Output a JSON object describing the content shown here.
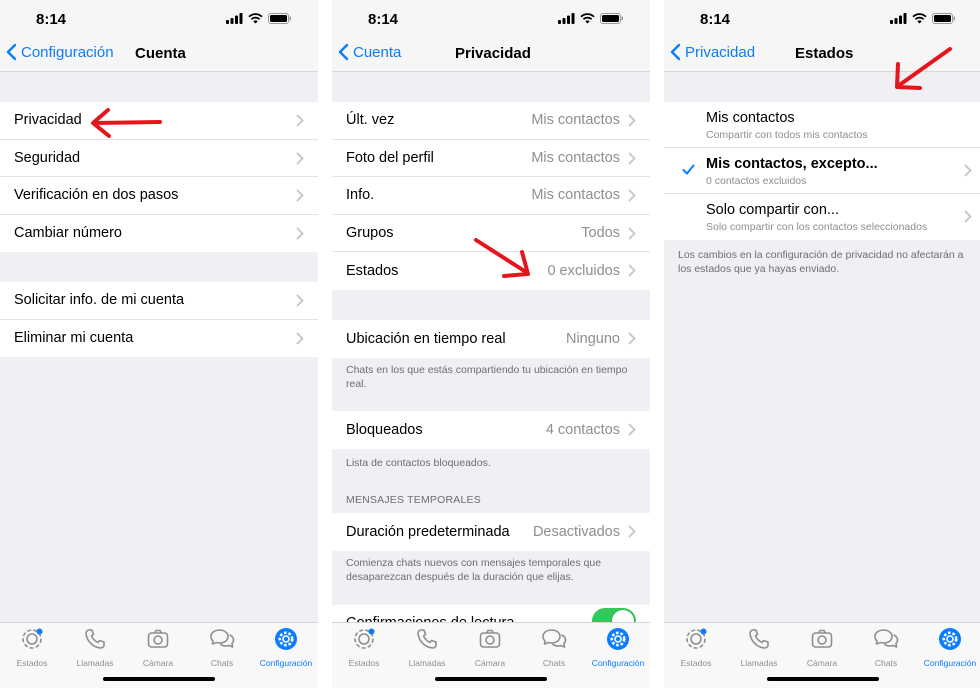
{
  "accent_color": "#0a7cff",
  "annotation_color": "#e8141b",
  "status": {
    "time": "8:14"
  },
  "tabs": [
    {
      "label": "Estados",
      "icon": "status-icon"
    },
    {
      "label": "Llamadas",
      "icon": "phone-icon"
    },
    {
      "label": "Cámara",
      "icon": "camera-icon"
    },
    {
      "label": "Chats",
      "icon": "chats-icon"
    },
    {
      "label": "Configuración",
      "icon": "gear-icon",
      "active": true
    }
  ],
  "screen1": {
    "back_label": "Configuración",
    "title": "Cuenta",
    "group1": [
      "Privacidad",
      "Seguridad",
      "Verificación en dos pasos",
      "Cambiar número"
    ],
    "group2": [
      "Solicitar info. de mi cuenta",
      "Eliminar mi cuenta"
    ]
  },
  "screen2": {
    "back_label": "Cuenta",
    "title": "Privacidad",
    "rows": [
      {
        "label": "Últ. vez",
        "value": "Mis contactos"
      },
      {
        "label": "Foto del perfil",
        "value": "Mis contactos"
      },
      {
        "label": "Info.",
        "value": "Mis contactos"
      },
      {
        "label": "Grupos",
        "value": "Todos"
      },
      {
        "label": "Estados",
        "value": "0 excluidos"
      }
    ],
    "location": {
      "label": "Ubicación en tiempo real",
      "value": "Ninguno"
    },
    "location_note": "Chats en los que estás compartiendo tu ubicación en tiempo real.",
    "blocked": {
      "label": "Bloqueados",
      "value": "4 contactos"
    },
    "blocked_note": "Lista de contactos bloqueados.",
    "temp_header": "MENSAJES TEMPORALES",
    "duration": {
      "label": "Duración predeterminada",
      "value": "Desactivados"
    },
    "duration_note": "Comienza chats nuevos con mensajes temporales que desaparezcan después de la duración que elijas.",
    "read_receipts": {
      "label": "Confirmaciones de lectura",
      "on": true
    }
  },
  "screen3": {
    "back_label": "Privacidad",
    "title": "Estados",
    "options": [
      {
        "title": "Mis contactos",
        "subtitle": "Compartir con todos mis contactos",
        "checked": false
      },
      {
        "title": "Mis contactos, excepto...",
        "subtitle": "0 contactos excluidos",
        "checked": true
      },
      {
        "title": "Solo compartir con...",
        "subtitle": "Solo compartir con los contactos seleccionados",
        "checked": false
      }
    ],
    "note": "Los cambios en la configuración de privacidad no afectarán a los estados que ya hayas enviado."
  }
}
